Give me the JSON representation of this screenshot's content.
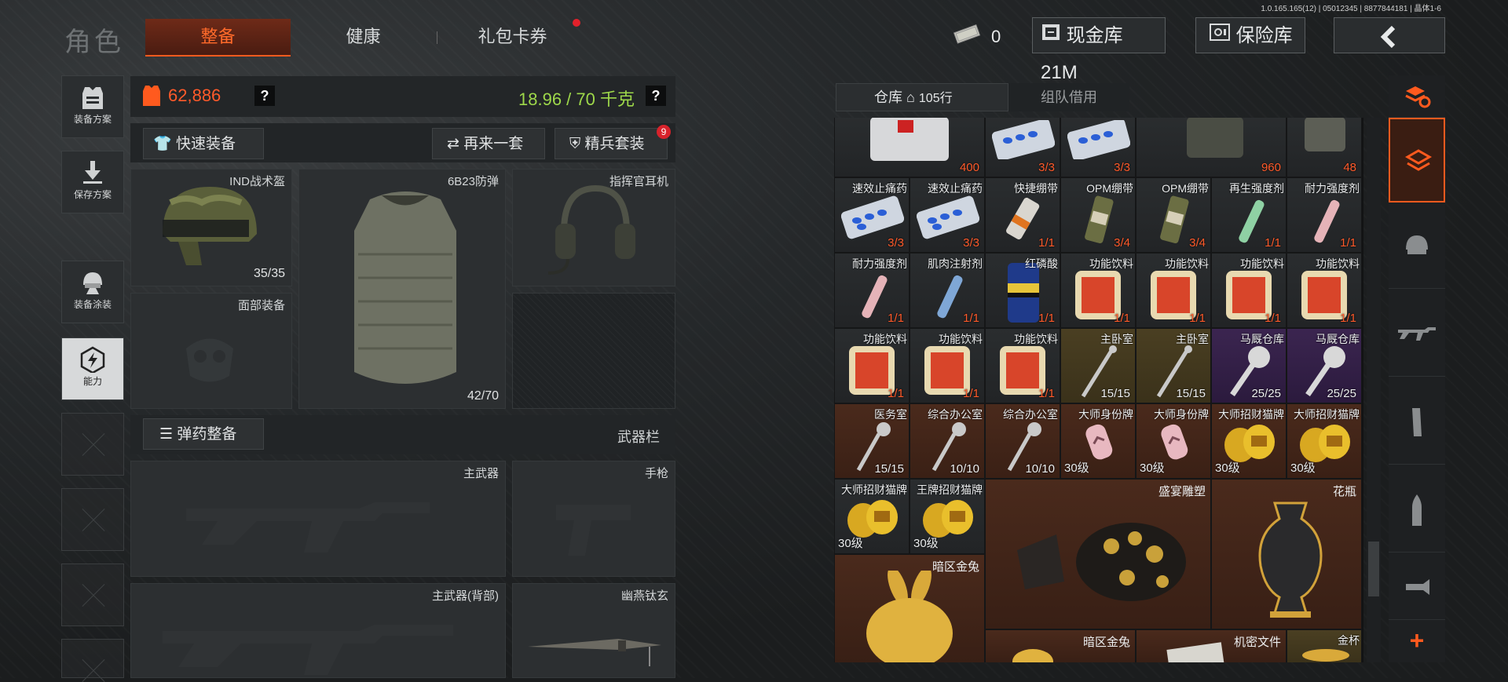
{
  "version": "1.0.165.165(12) | 05012345 | 8877844181 | 晶体1-6",
  "nav": {
    "title": "角色",
    "tabs": [
      {
        "label": "整备",
        "active": true
      },
      {
        "label": "健康",
        "active": false
      },
      {
        "label": "礼包卡券",
        "active": false
      }
    ]
  },
  "topbar": {
    "cash_count": "0",
    "cash_vault_label": "现金库 21M",
    "safe_label": "保险库"
  },
  "left_menu": [
    {
      "label": "装备方案",
      "icon": "vest-icon"
    },
    {
      "label": "保存方案",
      "icon": "download-icon"
    },
    {
      "label": "装备涂装",
      "icon": "helmet-paint-icon"
    },
    {
      "label": "能力",
      "icon": "lightning-hexagon-icon"
    }
  ],
  "stats": {
    "value": "62,886",
    "weight": "18.96 / 70 千克",
    "help": "?"
  },
  "quick": {
    "quick_equip": "快速装备",
    "again": "再来一套",
    "elite": "精兵套装",
    "elite_badge": "9",
    "ammo_equip": "弹药整备",
    "weapon_bar": "武器栏"
  },
  "gear": {
    "helmet": {
      "name": "IND战术盔",
      "count": "35/35"
    },
    "armor": {
      "name": "6B23防弹",
      "count": "42/70"
    },
    "headset": {
      "name": "指挥官耳机"
    },
    "face": {
      "name": "面部装备"
    },
    "primary": {
      "name": "主武器"
    },
    "pistol": {
      "name": "手枪"
    },
    "primary_back": {
      "name": "主武器(背部)"
    },
    "melee": {
      "name": "幽燕钛玄"
    }
  },
  "warehouse": {
    "tab_label": "仓库",
    "rows": "105行",
    "team_label": "组队借用",
    "row0": [
      {
        "label": "",
        "count": "400"
      },
      {
        "label": "",
        "count": "3/3"
      },
      {
        "label": "",
        "count": "3/3"
      },
      {
        "label": "",
        "count": "960"
      },
      {
        "label": "",
        "count": "48"
      }
    ],
    "row1": [
      {
        "label": "速效止痛药",
        "count": "3/3"
      },
      {
        "label": "速效止痛药",
        "count": "3/3"
      },
      {
        "label": "快捷绷带",
        "count": "1/1"
      },
      {
        "label": "OPM绷带",
        "count": "3/4"
      },
      {
        "label": "OPM绷带",
        "count": "3/4"
      },
      {
        "label": "再生强度剂",
        "count": "1/1"
      },
      {
        "label": "耐力强度剂",
        "count": "1/1"
      }
    ],
    "row2": [
      {
        "label": "耐力强度剂",
        "count": "1/1"
      },
      {
        "label": "肌肉注射剂",
        "count": "1/1"
      },
      {
        "label": "红磷酸",
        "count": "1/1"
      },
      {
        "label": "功能饮料",
        "count": "1/1"
      },
      {
        "label": "功能饮料",
        "count": "1/1"
      },
      {
        "label": "功能饮料",
        "count": "1/1"
      },
      {
        "label": "功能饮料",
        "count": "1/1"
      }
    ],
    "row3": [
      {
        "label": "功能饮料",
        "count": "1/1"
      },
      {
        "label": "功能饮料",
        "count": "1/1"
      },
      {
        "label": "功能饮料",
        "count": "1/1"
      },
      {
        "label": "主卧室",
        "count": "15/15"
      },
      {
        "label": "主卧室",
        "count": "15/15"
      },
      {
        "label": "马厩仓库",
        "count": "25/25"
      },
      {
        "label": "马厩仓库",
        "count": "25/25"
      }
    ],
    "row4": [
      {
        "label": "医务室",
        "count": "15/15"
      },
      {
        "label": "综合办公室",
        "count": "10/10"
      },
      {
        "label": "综合办公室",
        "count": "10/10"
      },
      {
        "label": "大师身份牌",
        "level": "30级"
      },
      {
        "label": "大师身份牌",
        "level": "30级"
      },
      {
        "label": "大师招财猫牌",
        "level": "30级"
      },
      {
        "label": "大师招财猫牌",
        "level": "30级"
      }
    ],
    "row5": [
      {
        "label": "大师招财猫牌",
        "level": "30级"
      },
      {
        "label": "王牌招财猫牌",
        "level": "30级"
      }
    ],
    "big_items": {
      "statue": "盛宴雕塑",
      "vase": "花瓶",
      "rabbit": "暗区金兔",
      "rabbit2": "暗区金兔",
      "secret": "机密文件",
      "cup": "金杯"
    }
  },
  "colors": {
    "accent": "#ff5a1e",
    "weight_green": "#9ed84a",
    "count_red": "#ff5a2a"
  }
}
